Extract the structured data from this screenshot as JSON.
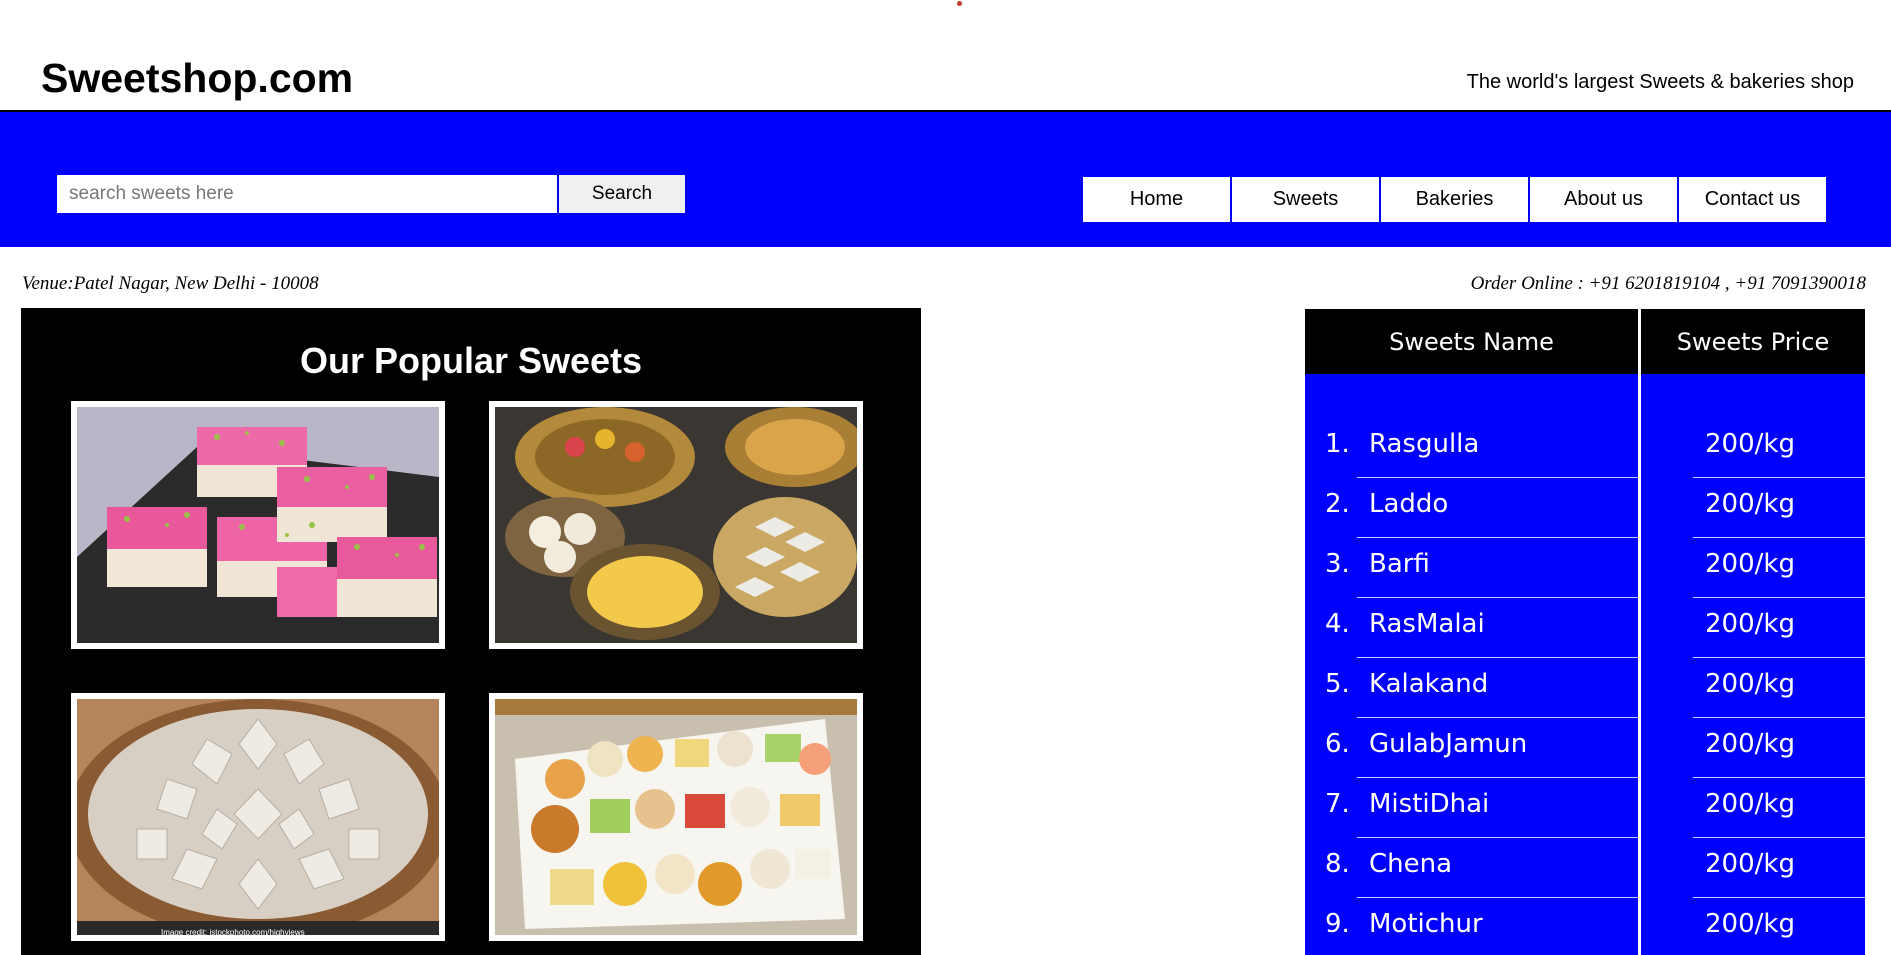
{
  "header": {
    "brand": "Sweetshop.com",
    "tagline": "The world's largest Sweets & bakeries shop"
  },
  "search": {
    "placeholder": "search sweets here",
    "button_label": "Search"
  },
  "nav": {
    "items": [
      "Home",
      "Sweets",
      "Bakeries",
      "About us",
      "Contact us"
    ]
  },
  "info": {
    "venue": "Venue:Patel Nagar, New Delhi - 10008",
    "order": "Order Online : +91 6201819104 , +91 7091390018"
  },
  "popular": {
    "title": "Our Popular Sweets",
    "photo_credit": "Image credit: istockphoto.com/highviews"
  },
  "price_table": {
    "header_name": "Sweets Name",
    "header_price": "Sweets Price",
    "rows": [
      {
        "num": "1.",
        "name": "Rasgulla",
        "price": "200/kg"
      },
      {
        "num": "2.",
        "name": "Laddo",
        "price": "200/kg"
      },
      {
        "num": "3.",
        "name": "Barfi",
        "price": "200/kg"
      },
      {
        "num": "4.",
        "name": "RasMalai",
        "price": "200/kg"
      },
      {
        "num": "5.",
        "name": "Kalakand",
        "price": "200/kg"
      },
      {
        "num": "6.",
        "name": "GulabJamun",
        "price": "200/kg"
      },
      {
        "num": "7.",
        "name": "MistiDhai",
        "price": "200/kg"
      },
      {
        "num": "8.",
        "name": "Chena",
        "price": "200/kg"
      },
      {
        "num": "9.",
        "name": "Motichur",
        "price": "200/kg"
      }
    ]
  },
  "colors": {
    "accent_blue": "#0000ff",
    "black": "#000000",
    "white": "#ffffff"
  }
}
